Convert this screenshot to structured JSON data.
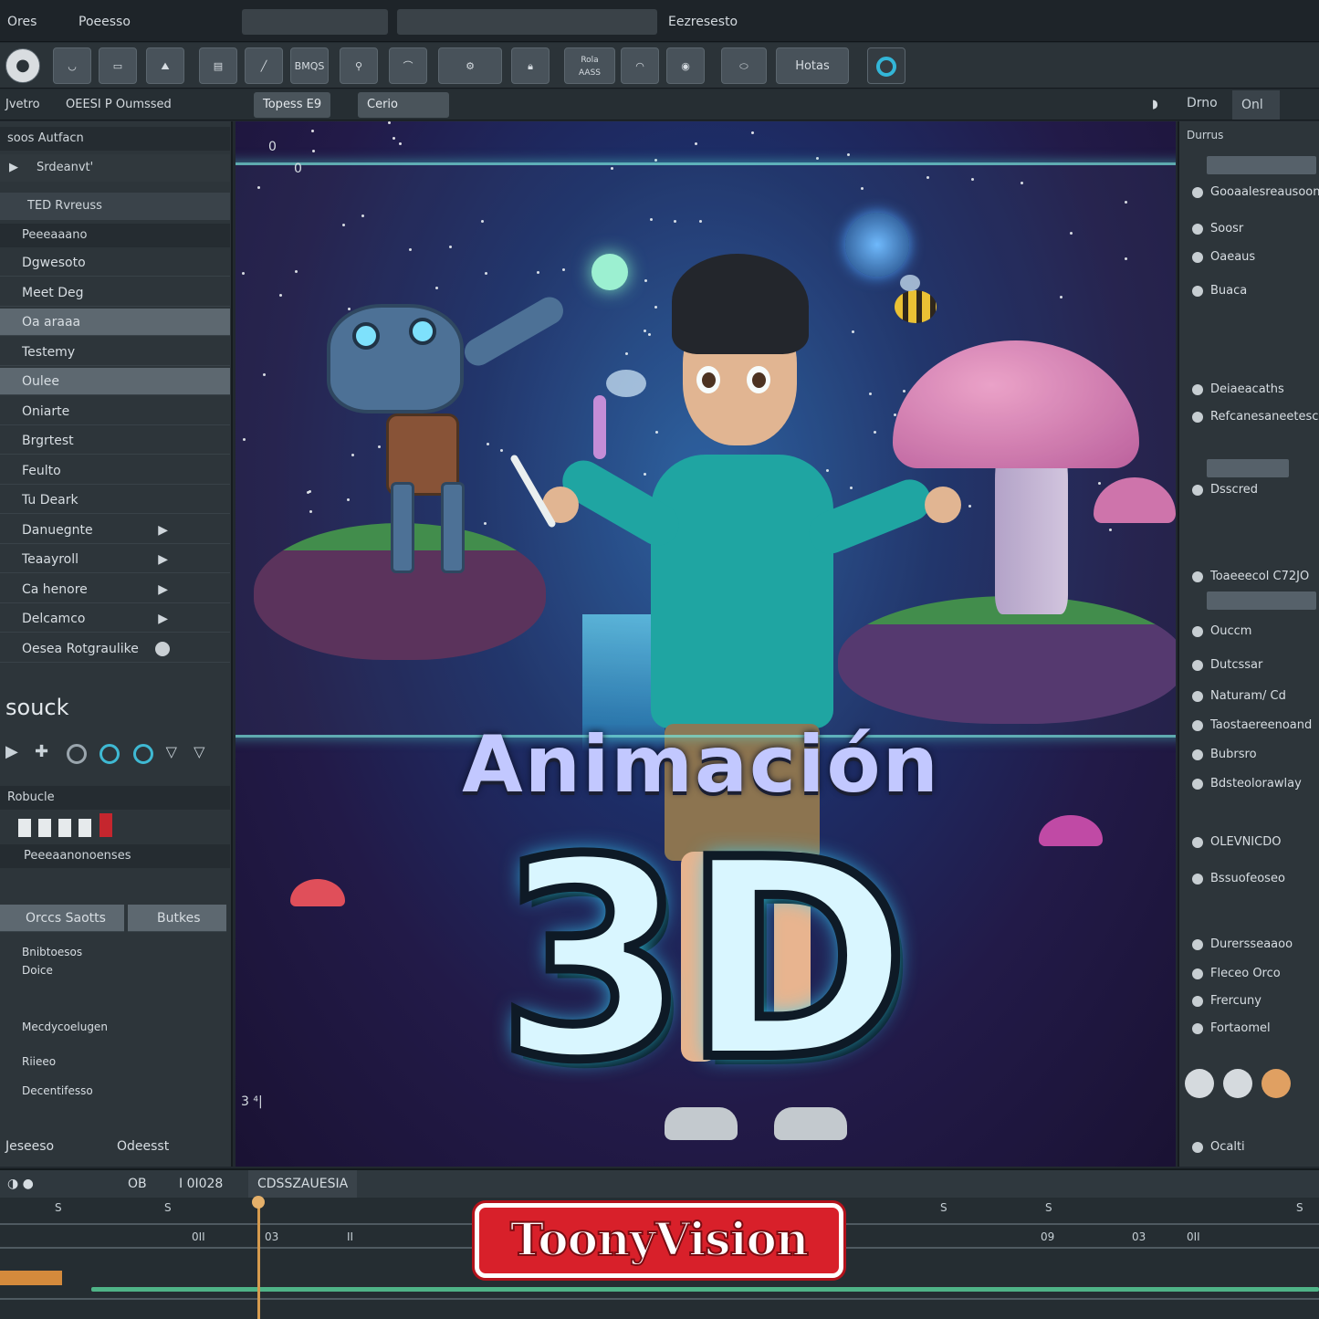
{
  "titlebar": {
    "app_label": "Ores",
    "menu_label": "Poeesso",
    "field_label": "Eezresesto"
  },
  "toolbar": {
    "tool_mode": "BMQS",
    "tool_block": "Rola\nAASS",
    "hotas_label": "Hotas"
  },
  "subbar": {
    "left_label": "Jvetro",
    "mid_label": "OEESI P Oumssed",
    "tab1": "Topess E9",
    "tab2": "Cerio"
  },
  "left_panel": {
    "search_label": "soos Autfacn",
    "play_label": "Srdeanvt'",
    "group_label": "TED Rvreuss",
    "header_label": "Peeeaaano",
    "items": [
      {
        "label": "Dgwesoto"
      },
      {
        "label": "Meet Deg"
      },
      {
        "label": "Oa araaa"
      },
      {
        "label": "Testemy"
      },
      {
        "label": "Oulee"
      },
      {
        "label": "Oniarte"
      },
      {
        "label": "Brgrtest"
      },
      {
        "label": "Feulto"
      },
      {
        "label": "Tu Deark"
      },
      {
        "label": "Danuegnte"
      },
      {
        "label": "Teaayroll"
      },
      {
        "label": "Ca henore"
      },
      {
        "label": "Delcamco"
      },
      {
        "label": "Oesea Rotgraulike"
      }
    ],
    "section_title": "souck",
    "props_label": "Robucle",
    "props_sub": "Peeeaanonoenses",
    "tab_a": "Orccs Saotts",
    "tab_b": "Butkes",
    "b_items": [
      {
        "label": "Bnibtoesos"
      },
      {
        "label": "Doice"
      },
      {
        "label": "Mecdycoelugen"
      },
      {
        "label": "Riieeo"
      },
      {
        "label": "Decentifesso"
      }
    ],
    "footer_left": "Jeseeso",
    "footer_right": "Odeesst"
  },
  "right_panel": {
    "tabs": [
      "Drno",
      "Onl"
    ],
    "header": "Durrus",
    "rows": [
      {
        "label": "Gooaalesreausoon"
      },
      {
        "label": "Soosr"
      },
      {
        "label": "Oaeaus"
      },
      {
        "label": "Buaca"
      },
      {
        "label": "Deiaeacaths"
      },
      {
        "label": "Refcanesaneeteschss"
      },
      {
        "label": "Dsscred"
      },
      {
        "label": "Toaeeecol C72JO"
      },
      {
        "label": "Ouccm"
      },
      {
        "label": "Dutcssar"
      },
      {
        "label": "Naturam/ Cd"
      },
      {
        "label": "Taostaereenoand"
      },
      {
        "label": "Bubrsro"
      },
      {
        "label": "Bdsteolorawlay"
      },
      {
        "label": "OLEVNICDO"
      },
      {
        "label": "Bssuofeoseo"
      },
      {
        "label": "Durersseaaoo"
      },
      {
        "label": "Fleceo Orco"
      },
      {
        "label": "Frercuny"
      },
      {
        "label": "Fortaomel"
      },
      {
        "label": "Ocalti"
      }
    ]
  },
  "viewport": {
    "title_word": "Animación",
    "title_big": "3D",
    "corner_top_a": "0",
    "corner_top_b": "0",
    "corner_bottom": "3 ⁴|"
  },
  "timeline": {
    "frame_a": "OB",
    "frame_b": "I 0I028",
    "clip_label": "CDSSZAUESIA",
    "ticks": [
      "S",
      "S",
      "S",
      "S",
      "S"
    ],
    "nums": [
      "0II",
      "03",
      "II",
      "09",
      "03",
      "0II"
    ]
  },
  "brand": {
    "logo_text": "ToonyVision"
  },
  "colors": {
    "accent_teal": "#1aa3a0",
    "glow": "#38d6ff",
    "logo_red": "#d8202a",
    "playhead": "#d59a4e"
  }
}
